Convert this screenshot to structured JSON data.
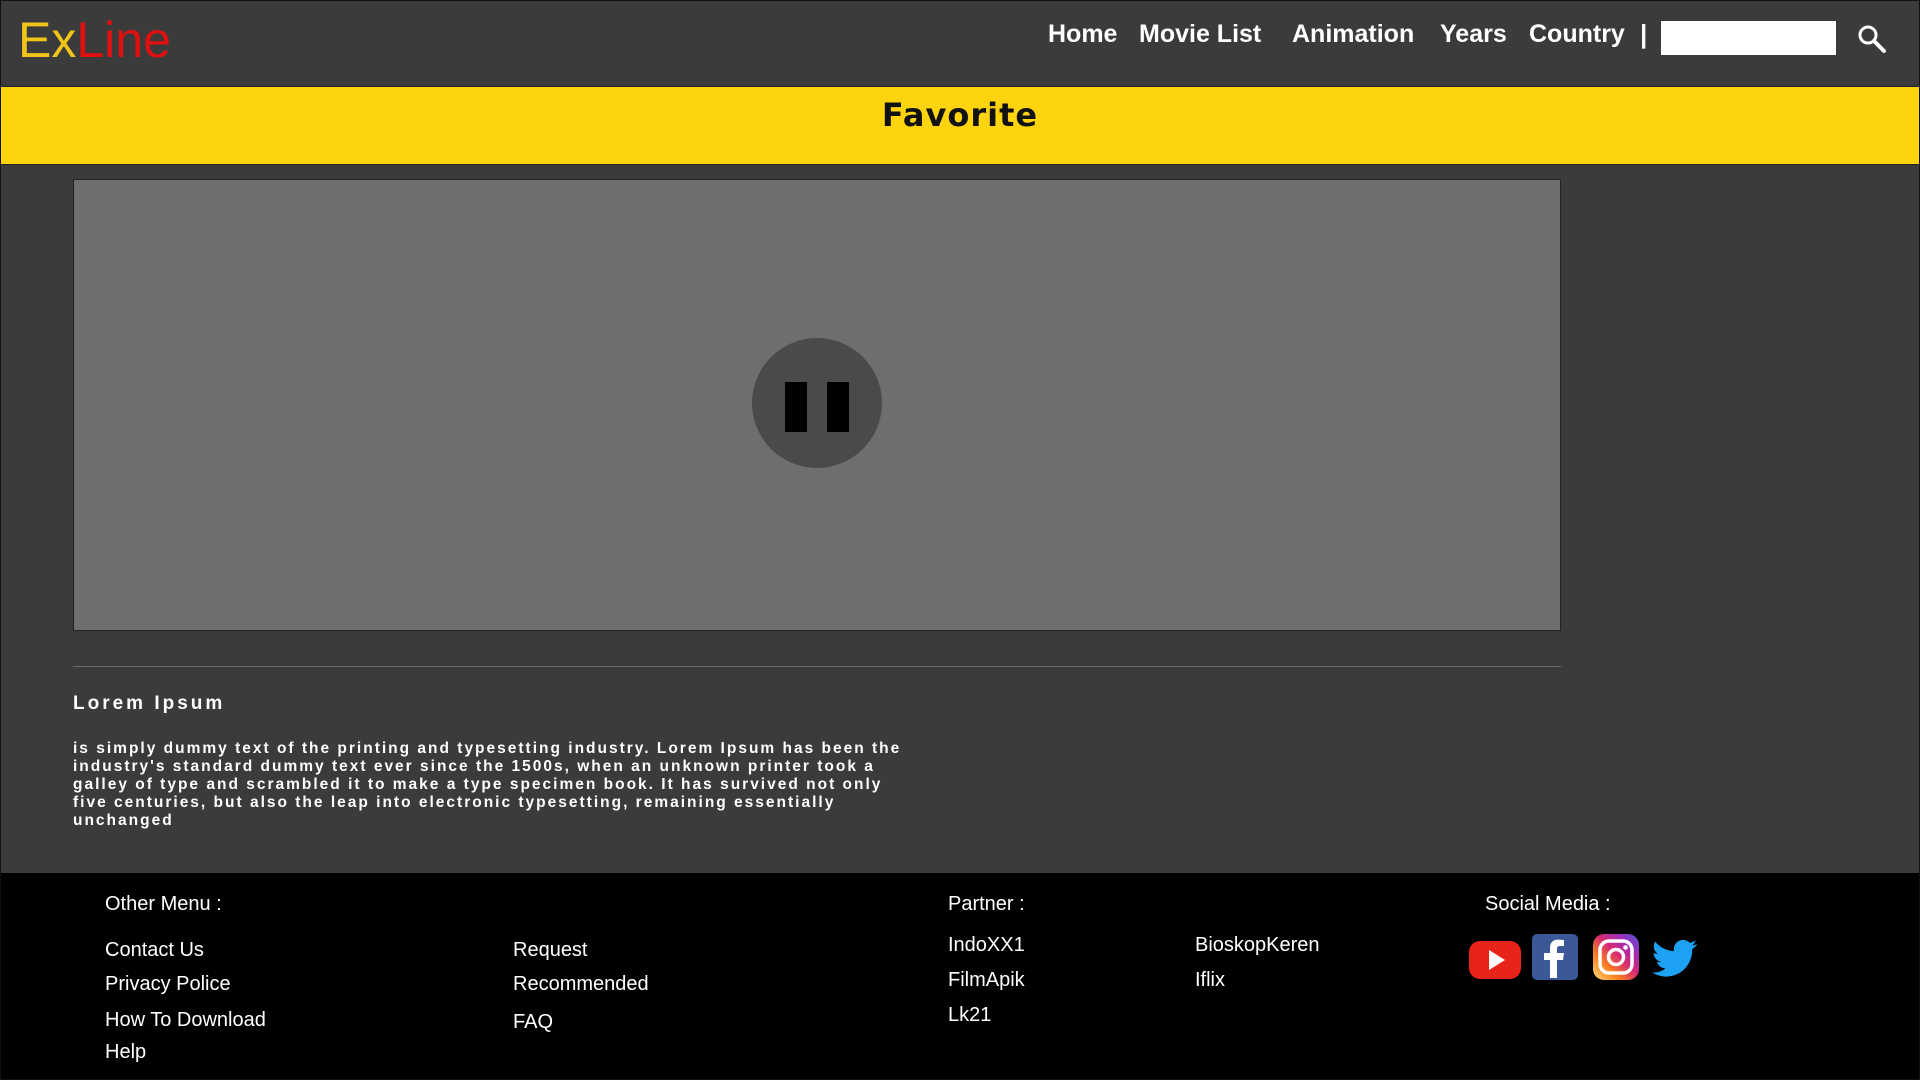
{
  "header": {
    "logo_part1": "Ex",
    "logo_part2": "Line",
    "nav": [
      "Home",
      "Movie List",
      "Animation",
      "Years",
      "Country"
    ],
    "separator": "|",
    "search_placeholder": ""
  },
  "banner": {
    "title": "Favorite"
  },
  "video": {
    "state": "playing",
    "control_icon": "pause-icon"
  },
  "description": {
    "title": "Lorem Ipsum",
    "text": "is simply dummy text of the printing and typesetting industry. Lorem Ipsum has been the industry's standard dummy text ever since the 1500s, when an unknown printer took a galley of type and scrambled it to make a type specimen book. It has survived not only five centuries, but also the leap into electronic typesetting, remaining essentially unchanged"
  },
  "footer": {
    "other_menu_heading": "Other Menu :",
    "other_menu_col1": [
      "Contact Us",
      "Privacy Police",
      "How To Download",
      "Help"
    ],
    "other_menu_col2": [
      "Request",
      "Recommended",
      "FAQ"
    ],
    "partner_heading": "Partner :",
    "partner_col1": [
      "IndoXX1",
      "FilmApik",
      "Lk21"
    ],
    "partner_col2": [
      "BioskopKeren",
      "Iflix"
    ],
    "social_heading": "Social Media :",
    "social_icons": [
      "youtube-icon",
      "facebook-icon",
      "instagram-icon",
      "twitter-icon"
    ]
  },
  "colors": {
    "banner": "#fdd40e",
    "logo_ex": "#f0c419",
    "logo_line": "#e01010",
    "background": "#3b3b3b",
    "footer": "#000000"
  }
}
